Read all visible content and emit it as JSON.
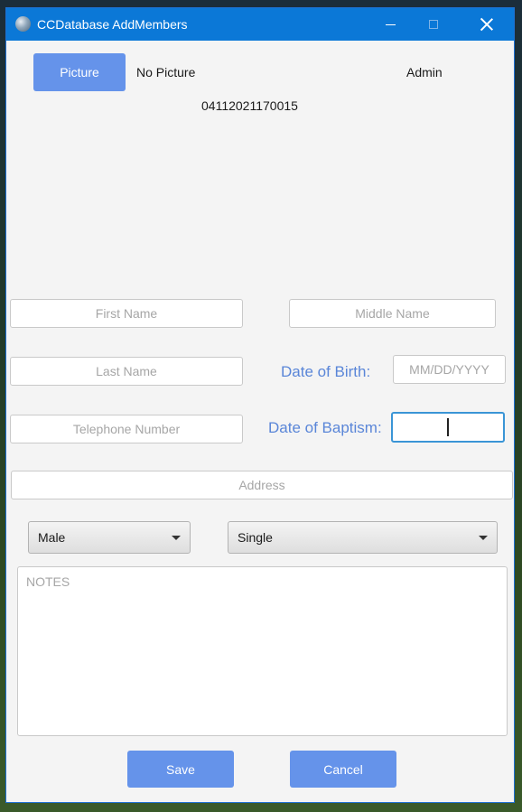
{
  "window": {
    "title": "CCDatabase AddMembers",
    "icon": "app-globe-icon"
  },
  "header": {
    "picture_button_label": "Picture",
    "picture_status": "No Picture",
    "user_role": "Admin",
    "member_id": "04112021170015"
  },
  "form": {
    "first_name_placeholder": "First Name",
    "middle_name_placeholder": "Middle Name",
    "last_name_placeholder": "Last Name",
    "dob_label": "Date of Birth:",
    "dob_placeholder": "MM/DD/YYYY",
    "telephone_placeholder": "Telephone Number",
    "baptism_label": "Date of Baptism:",
    "baptism_value": "",
    "address_placeholder": "Address",
    "gender_selected": "Male",
    "civil_status_selected": "Single",
    "notes_placeholder": "NOTES"
  },
  "actions": {
    "save_label": "Save",
    "cancel_label": "Cancel"
  },
  "colors": {
    "titlebar": "#0b78d7",
    "button": "#6593ea",
    "label_accent": "#5a86d8",
    "focus_border": "#3a95d6"
  }
}
